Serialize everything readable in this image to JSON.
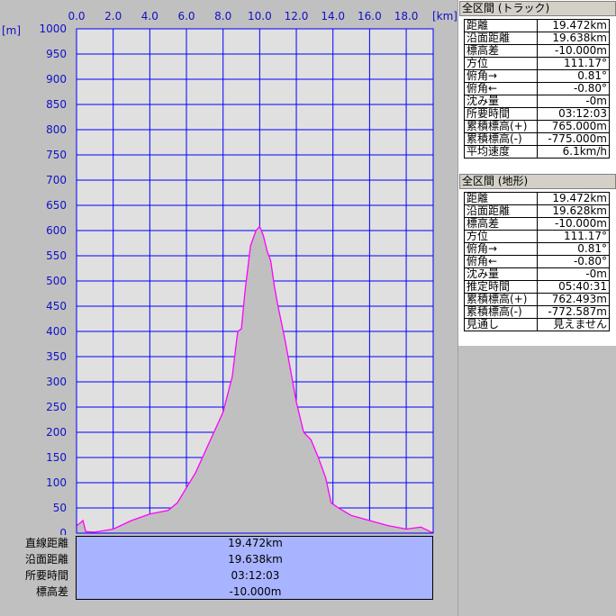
{
  "chart_data": {
    "type": "area",
    "xlabel": "[km]",
    "ylabel": "[m]",
    "xlim": [
      0,
      19.472
    ],
    "ylim": [
      0,
      1000
    ],
    "x_ticks": [
      "0.0",
      "2.0",
      "4.0",
      "6.0",
      "8.0",
      "10.0",
      "12.0",
      "14.0",
      "16.0",
      "18.0"
    ],
    "y_ticks": [
      "1000",
      "950",
      "900",
      "850",
      "800",
      "750",
      "700",
      "650",
      "600",
      "550",
      "500",
      "450",
      "400",
      "350",
      "300",
      "250",
      "200",
      "150",
      "100",
      "50",
      "0"
    ],
    "grid": true,
    "line_color": "#ff00ff",
    "fill_color": "#c0c0c0",
    "plot_bg": "#e0e0e0",
    "grid_color": "#0000ff",
    "x": [
      0.0,
      0.2,
      0.35,
      0.5,
      1.0,
      2.0,
      3.0,
      4.0,
      5.0,
      5.5,
      6.0,
      6.5,
      7.0,
      7.5,
      8.0,
      8.5,
      8.8,
      9.0,
      9.2,
      9.5,
      9.8,
      10.0,
      10.2,
      10.4,
      10.6,
      10.8,
      11.0,
      11.4,
      11.8,
      12.0,
      12.4,
      12.8,
      13.2,
      13.6,
      13.9,
      14.1,
      14.3,
      15.0,
      16.0,
      17.0,
      18.0,
      18.8,
      19.2,
      19.472
    ],
    "y": [
      15,
      20,
      25,
      3,
      2,
      8,
      25,
      38,
      45,
      60,
      90,
      120,
      160,
      200,
      240,
      310,
      400,
      405,
      480,
      570,
      600,
      608,
      590,
      560,
      540,
      490,
      450,
      380,
      300,
      260,
      200,
      185,
      150,
      110,
      60,
      55,
      50,
      35,
      25,
      15,
      8,
      12,
      5,
      0
    ]
  },
  "summary": {
    "rows": [
      {
        "label": "直線距離",
        "value": "19.472km"
      },
      {
        "label": "沿面距離",
        "value": "19.638km"
      },
      {
        "label": "所要時間",
        "value": "03:12:03"
      },
      {
        "label": "標高差",
        "value": "-10.000m"
      }
    ],
    "box_color": "#a8b4ff"
  },
  "panel_track": {
    "title": "全区間 (トラック)",
    "rows": [
      {
        "label": "距離",
        "value": "19.472km"
      },
      {
        "label": "沿面距離",
        "value": "19.638km"
      },
      {
        "label": "標高差",
        "value": "-10.000m"
      },
      {
        "label": "方位",
        "value": "111.17°"
      },
      {
        "label": "俯角→",
        "value": "0.81°"
      },
      {
        "label": "俯角←",
        "value": "-0.80°"
      },
      {
        "label": "沈み量",
        "value": "-0m"
      },
      {
        "label": "所要時間",
        "value": "03:12:03"
      },
      {
        "label": "累積標高(+)",
        "value": "765.000m"
      },
      {
        "label": "累積標高(-)",
        "value": "-775.000m"
      },
      {
        "label": "平均速度",
        "value": "6.1km/h"
      }
    ]
  },
  "panel_terrain": {
    "title": "全区間 (地形)",
    "rows": [
      {
        "label": "距離",
        "value": "19.472km"
      },
      {
        "label": "沿面距離",
        "value": "19.628km"
      },
      {
        "label": "標高差",
        "value": "-10.000m"
      },
      {
        "label": "方位",
        "value": "111.17°"
      },
      {
        "label": "俯角→",
        "value": "0.81°"
      },
      {
        "label": "俯角←",
        "value": "-0.80°"
      },
      {
        "label": "沈み量",
        "value": "-0m"
      },
      {
        "label": "推定時間",
        "value": "05:40:31"
      },
      {
        "label": "累積標高(+)",
        "value": "762.493m"
      },
      {
        "label": "累積標高(-)",
        "value": "-772.587m"
      },
      {
        "label": "見通し",
        "value": "見えません"
      }
    ]
  }
}
